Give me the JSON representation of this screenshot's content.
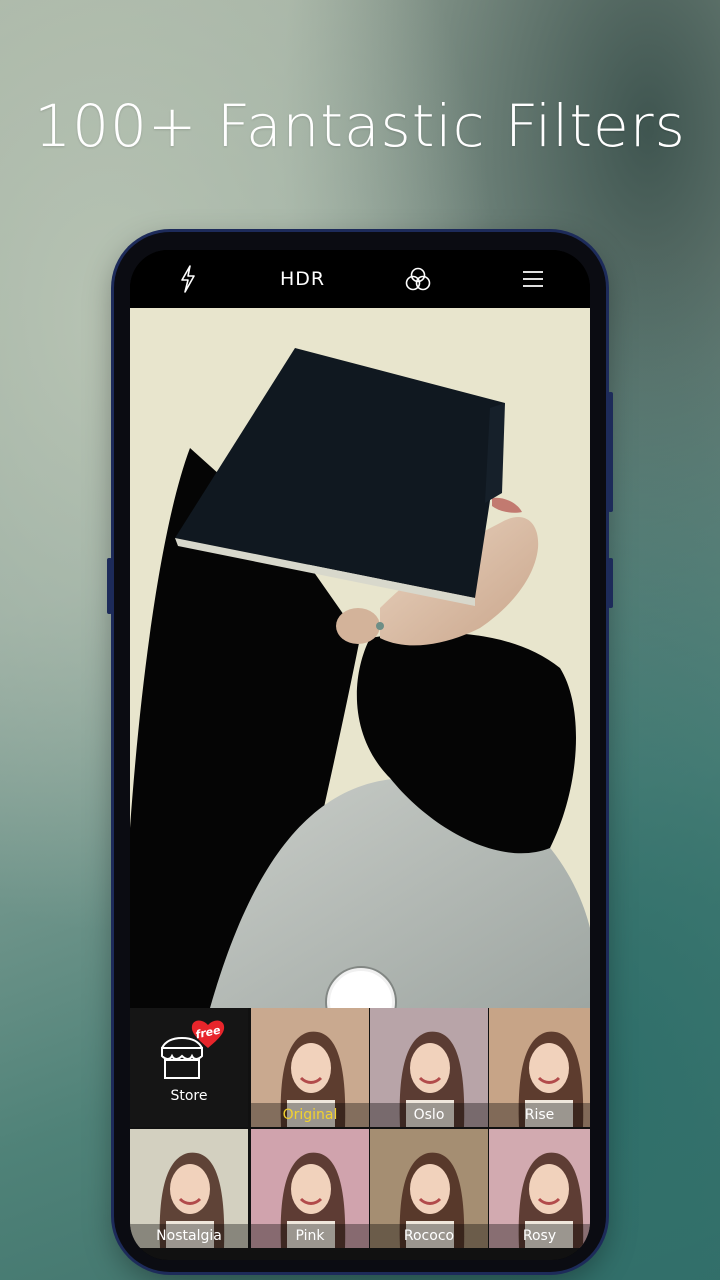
{
  "headline": "100+ Fantastic Filters",
  "toolbar": {
    "flash_icon": "flash-icon",
    "hdr_label": "HDR",
    "filters_icon": "filter-circles-icon",
    "menu_icon": "menu-icon"
  },
  "store": {
    "label": "Store",
    "badge": "free"
  },
  "filters": [
    {
      "label": "Original",
      "selected": true,
      "tint": "#c9a98f",
      "label_color": "#f2d22e"
    },
    {
      "label": "Oslo",
      "selected": false,
      "tint": "#b8a4a8",
      "label_color": "#ffffff"
    },
    {
      "label": "Rise",
      "selected": false,
      "tint": "#c7a487",
      "label_color": "#ffffff"
    },
    {
      "label": "Nostalgia",
      "selected": false,
      "tint": "#d3d0c0",
      "label_color": "#ffffff"
    },
    {
      "label": "Pink",
      "selected": false,
      "tint": "#d0a3ad",
      "label_color": "#ffffff"
    },
    {
      "label": "Rococo",
      "selected": false,
      "tint": "#a58e72",
      "label_color": "#ffffff"
    },
    {
      "label": "Rosy",
      "selected": false,
      "tint": "#d2aab0",
      "label_color": "#ffffff"
    }
  ],
  "colors": {
    "phone_frame": "#1d2b5a",
    "selected_label": "#f2d22e",
    "badge_red": "#e8252b"
  }
}
